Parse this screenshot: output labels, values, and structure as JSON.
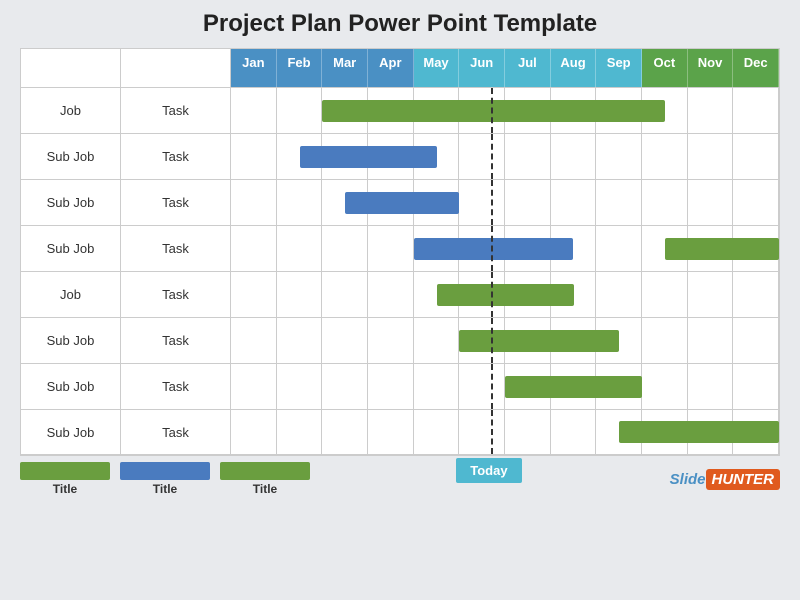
{
  "title": "Project Plan Power Point Template",
  "months": [
    "Jan",
    "Feb",
    "Mar",
    "Apr",
    "May",
    "Jun",
    "Jul",
    "Aug",
    "Sep",
    "Oct",
    "Nov",
    "Dec"
  ],
  "monthColors": [
    "blue",
    "blue",
    "blue",
    "blue",
    "teal",
    "teal",
    "teal",
    "teal",
    "teal",
    "green-h",
    "green-h",
    "green-h"
  ],
  "rows": [
    {
      "job": "Job",
      "task": "Task",
      "barColor": "green",
      "barStart": 2,
      "barEnd": 9.5
    },
    {
      "job": "Sub Job",
      "task": "Task",
      "barColor": "blue",
      "barStart": 1.5,
      "barEnd": 4.5
    },
    {
      "job": "Sub Job",
      "task": "Task",
      "barColor": "blue",
      "barStart": 2.5,
      "barEnd": 5.0
    },
    {
      "job": "Sub Job",
      "task": "Task",
      "barColor": "blue",
      "barStart": 4.0,
      "barEnd": 7.5,
      "barColor2": "green",
      "barStart2": 9.5,
      "barEnd2": 12
    },
    {
      "job": "Job",
      "task": "Task",
      "barColor": "green",
      "barStart": 4.5,
      "barEnd": 7.5
    },
    {
      "job": "Sub Job",
      "task": "Task",
      "barColor": "green",
      "barStart": 5.0,
      "barEnd": 8.5
    },
    {
      "job": "Sub Job",
      "task": "Task",
      "barColor": "green",
      "barStart": 6.0,
      "barEnd": 9.0
    },
    {
      "job": "Sub Job",
      "task": "Task",
      "barColor": "green",
      "barStart": 8.5,
      "barEnd": 12
    }
  ],
  "todayPosition": 5.7,
  "todayLabel": "Today",
  "legend": [
    {
      "color": "#6a9e3f",
      "label": "Title"
    },
    {
      "color": "#4a7bbf",
      "label": "Title"
    },
    {
      "color": "#6a9e3f",
      "label": "Title"
    }
  ],
  "brand": {
    "slide": "Slide",
    "hunter": "HUNTER"
  }
}
